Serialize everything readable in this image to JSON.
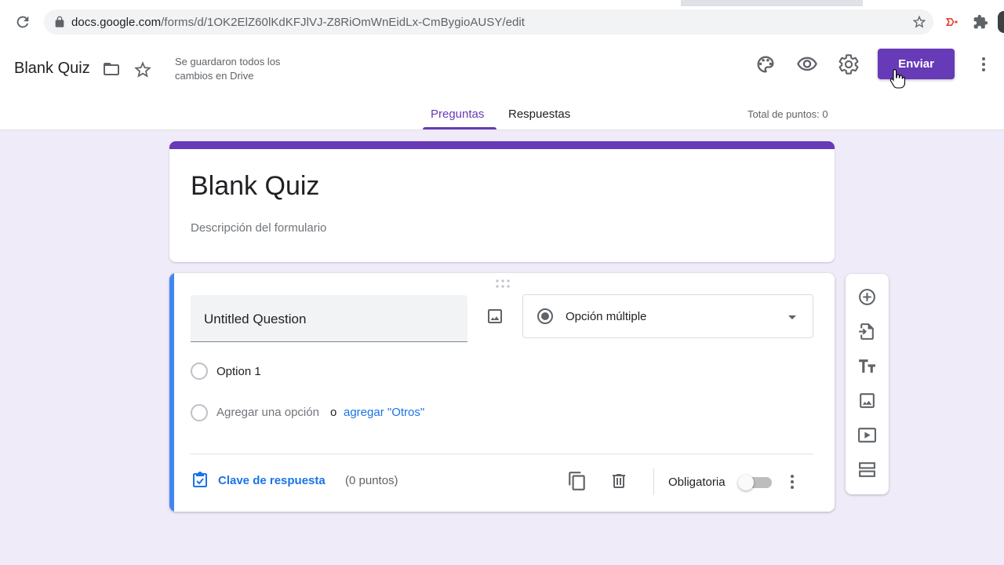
{
  "browser": {
    "url_host": "docs.google.com",
    "url_path": "/forms/d/1OK2ElZ60lKdKFJlVJ-Z8RiOmWnEidLx-CmBygioAUSY/edit"
  },
  "header": {
    "doc_title": "Blank Quiz",
    "save_status": "Se guardaron todos los cambios en Drive",
    "send_label": "Enviar",
    "tabs": [
      {
        "label": "Preguntas",
        "active": true
      },
      {
        "label": "Respuestas",
        "active": false
      }
    ],
    "total_points": "Total de puntos: 0"
  },
  "form": {
    "title": "Blank Quiz",
    "description": "Descripción del formulario"
  },
  "question": {
    "title": "Untitled Question",
    "type": "Opción múltiple",
    "options": [
      "Option 1"
    ],
    "add_option": "Agregar una opción",
    "or": "o",
    "add_other": "agregar \"Otros\"",
    "answer_key": "Clave de respuesta",
    "points": "(0 puntos)",
    "required_label": "Obligatoria",
    "required": false
  },
  "toolbar_icons": [
    "add-question-icon",
    "import-questions-icon",
    "add-title-icon",
    "add-image-icon",
    "add-video-icon",
    "add-section-icon"
  ],
  "colors": {
    "accent": "#673ab7",
    "background": "#f0ebf8",
    "active_question": "#4285f4",
    "link": "#1a73e8"
  }
}
